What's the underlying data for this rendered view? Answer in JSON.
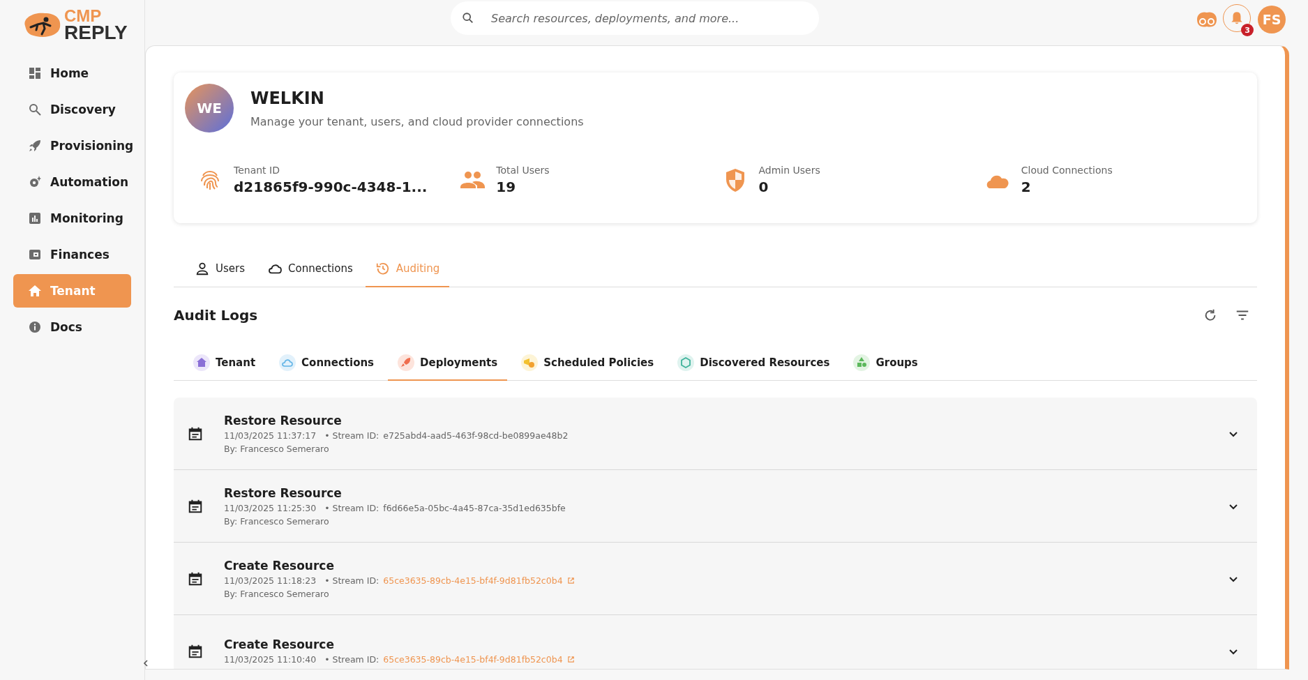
{
  "logo": {
    "line_1": "CMP",
    "line_2": "REPLY"
  },
  "search": {
    "placeholder": "Search resources, deployments, and more..."
  },
  "header": {
    "notification_count": "3",
    "avatar": "FS"
  },
  "sidebar": {
    "items": [
      {
        "label": "Home",
        "selected": false
      },
      {
        "label": "Discovery",
        "selected": false
      },
      {
        "label": "Provisioning",
        "selected": false
      },
      {
        "label": "Automation",
        "selected": false
      },
      {
        "label": "Monitoring",
        "selected": false
      },
      {
        "label": "Finances",
        "selected": false
      },
      {
        "label": "Tenant",
        "selected": true
      },
      {
        "label": "Docs",
        "selected": false
      }
    ]
  },
  "tenant": {
    "initials": "WE",
    "name": "WELKIN",
    "description": "Manage your tenant, users, and cloud provider connections",
    "stats": [
      {
        "label": "Tenant ID",
        "value": "d21865f9-990c-4348-1..."
      },
      {
        "label": "Total Users",
        "value": "19"
      },
      {
        "label": "Admin Users",
        "value": "0"
      },
      {
        "label": "Cloud Connections",
        "value": "2"
      }
    ]
  },
  "tabs": [
    {
      "label": "Users",
      "selected": false
    },
    {
      "label": "Connections",
      "selected": false
    },
    {
      "label": "Auditing",
      "selected": true
    }
  ],
  "audit": {
    "title": "Audit Logs",
    "categories": [
      {
        "label": "Tenant",
        "selected": false
      },
      {
        "label": "Connections",
        "selected": false
      },
      {
        "label": "Deployments",
        "selected": true
      },
      {
        "label": "Scheduled Policies",
        "selected": false
      },
      {
        "label": "Discovered Resources",
        "selected": false
      },
      {
        "label": "Groups",
        "selected": false
      }
    ],
    "entries": [
      {
        "action": "Restore Resource",
        "timestamp": "11/03/2025 11:37:17",
        "stream_label": "• Stream ID:",
        "stream_id": "e725abd4-aad5-463f-98cd-be0899ae48b2",
        "linked": false,
        "author": "By: Francesco Semeraro"
      },
      {
        "action": "Restore Resource",
        "timestamp": "11/03/2025 11:25:30",
        "stream_label": "• Stream ID:",
        "stream_id": "f6d66e5a-05bc-4a45-87ca-35d1ed635bfe",
        "linked": false,
        "author": "By: Francesco Semeraro"
      },
      {
        "action": "Create Resource",
        "timestamp": "11/03/2025 11:18:23",
        "stream_label": "• Stream ID:",
        "stream_id": "65ce3635-89cb-4e15-bf4f-9d81fb52c0b4",
        "linked": true,
        "author": "By: Francesco Semeraro"
      },
      {
        "action": "Create Resource",
        "timestamp": "11/03/2025 11:10:40",
        "stream_label": "• Stream ID:",
        "stream_id": "65ce3635-89cb-4e15-bf4f-9d81fb52c0b4",
        "linked": true
      }
    ]
  }
}
